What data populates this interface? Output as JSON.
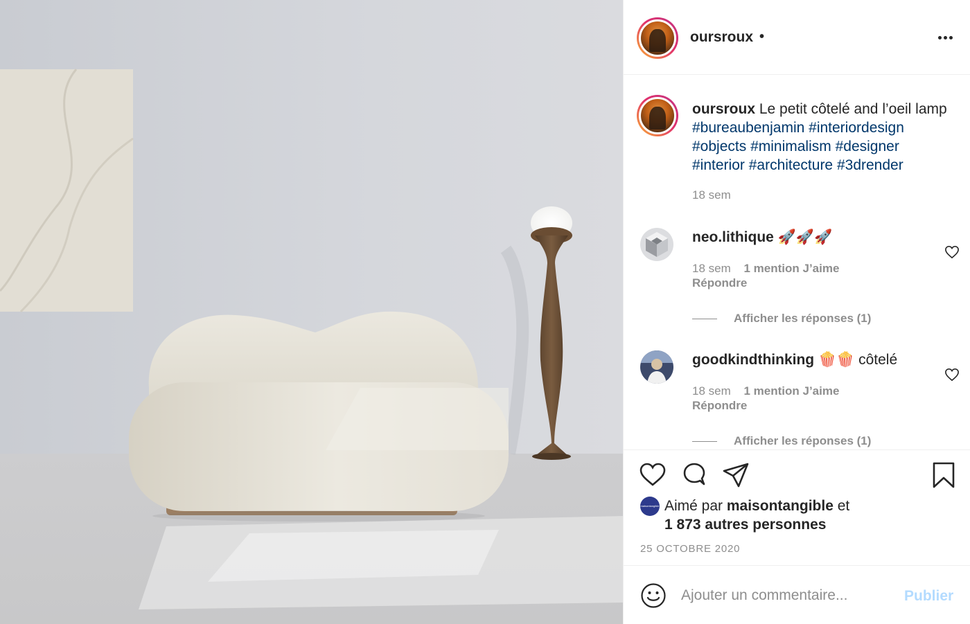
{
  "post": {
    "author": "oursroux",
    "header_dot": "•",
    "more_icon": "more-horizontal-icon",
    "image_alt": "Le petit côtelé and l'oeil lamp render"
  },
  "caption": {
    "user": "oursroux",
    "text": "Le petit côtelé and l’oeil lamp",
    "hashtags_line1": [
      "#bureaubenjamin",
      "#interiordesign"
    ],
    "hashtags_line2": [
      "#objects",
      "#minimalism",
      "#designer"
    ],
    "hashtags_line3": [
      "#interior",
      "#architecture",
      "#3drender"
    ],
    "time": "18 sem"
  },
  "comments": [
    {
      "user": "neo.lithique",
      "text": "🚀🚀🚀",
      "time": "18 sem",
      "likes": "1 mention J’aime",
      "reply": "Répondre",
      "view_replies": "Afficher les réponses (1)"
    },
    {
      "user": "goodkindthinking",
      "text": "🍿🍿 côtelé",
      "time": "18 sem",
      "likes": "1 mention J’aime",
      "reply": "Répondre",
      "view_replies": "Afficher les réponses (1)"
    }
  ],
  "actions": {
    "icons": [
      "heart-icon",
      "comment-icon",
      "share-icon",
      "bookmark-icon"
    ],
    "liked_prefix": "Aimé par",
    "liked_user": "maisontangible",
    "liked_suffix": "et",
    "liked_others": "1 873 autres personnes",
    "liked_avatar_text": "maisontangible",
    "date": "25 OCTOBRE 2020"
  },
  "add_comment": {
    "placeholder": "Ajouter un commentaire...",
    "publish": "Publier"
  },
  "colors": {
    "hashtag": "#00376b",
    "secondary_text": "#8e8e8e",
    "publish_disabled": "#b3dbff"
  }
}
